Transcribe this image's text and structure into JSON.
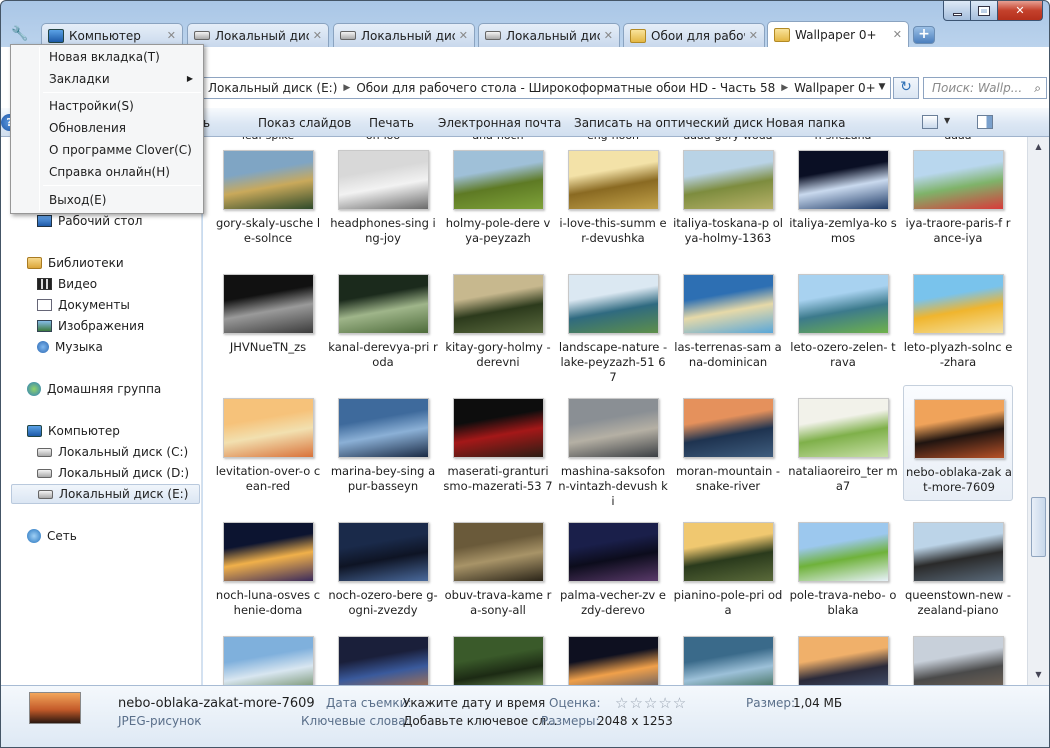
{
  "window": {
    "minimize": "—",
    "maximize": "□",
    "close": "✕"
  },
  "tabs": [
    {
      "label": "Компьютер",
      "icon": "computer-icon",
      "close": "✕"
    },
    {
      "label": "Локальный диск",
      "icon": "drive-icon",
      "close": "✕"
    },
    {
      "label": "Локальный диск",
      "icon": "drive-icon",
      "close": "✕"
    },
    {
      "label": "Локальный диск",
      "icon": "drive-icon",
      "close": "✕"
    },
    {
      "label": "Обои для рабочего стола",
      "icon": "folder-icon",
      "close": "✕"
    },
    {
      "label": "Wallpaper 0+",
      "icon": "folder-icon",
      "close": "✕"
    }
  ],
  "new_tab": "+",
  "address": {
    "crumbs": [
      "Локальный диск (E:)",
      "Обои для рабочего стола - Широкоформатные обои HD - Часть 58",
      "Wallpaper 0+"
    ],
    "sep": "▶",
    "refresh": "↻",
    "search_placeholder": "Поиск: Wallp...",
    "search_icon": "⌕"
  },
  "commands": [
    "Показ слайдов",
    "Печать",
    "Электронная почта",
    "Записать на оптический диск",
    "Новая папка"
  ],
  "command_stub": "ь",
  "help": "?",
  "menu": {
    "items": [
      "Новая вкладка(T)",
      "Закладки",
      "Настройки(S)",
      "Обновления",
      "О программе Clover(C)",
      "Справка онлайн(H)",
      "Выход(E)"
    ],
    "submenu_arrow": "▶"
  },
  "nav": {
    "desktop": "Рабочий стол",
    "libraries": "Библиотеки",
    "video": "Видео",
    "documents": "Документы",
    "images": "Изображения",
    "music": "Музыка",
    "homegroup": "Домашняя группа",
    "computer": "Компьютер",
    "drive_c": "Локальный диск (C:)",
    "drive_d": "Локальный диск (D:)",
    "drive_e": "Локальный диск (E:)",
    "network": "Сеть"
  },
  "top_partial": [
    "leaf-spike",
    "on-ioo",
    "ana-noch",
    "eng-noon",
    "aaaa-gory-woda",
    "n-snezana",
    "aaaa"
  ],
  "files": [
    {
      "name": "gory-skaly-usche le-solnce",
      "colors": [
        "#7fa5c4",
        "#2e4a2a",
        "#c9a95b"
      ]
    },
    {
      "name": "headphones-sing ing-joy",
      "colors": [
        "#d8d8d8",
        "#6a6a6a",
        "#f2f2f2"
      ]
    },
    {
      "name": "holmy-pole-dere vya-peyzazh",
      "colors": [
        "#9fc0d8",
        "#7fa33a",
        "#5e7a24"
      ]
    },
    {
      "name": "i-love-this-summ er-devushka",
      "colors": [
        "#f3e2a8",
        "#c2a24a",
        "#8a6a22"
      ]
    },
    {
      "name": "italiya-toskana-p olya-holmy-1363",
      "colors": [
        "#b9d3e6",
        "#b8b26a",
        "#7d8c3e"
      ]
    },
    {
      "name": "italiya-zemlya-ko smos",
      "colors": [
        "#0a0f24",
        "#1e3a66",
        "#c9d9ee"
      ]
    },
    {
      "name": "iya-traore-paris-f rance-iya",
      "colors": [
        "#b9d7ee",
        "#d93a3a",
        "#7fb36a"
      ]
    },
    {
      "name": "JHVNueTN_zs",
      "colors": [
        "#111",
        "#3b3b3b",
        "#9a9a9a"
      ]
    },
    {
      "name": "kanal-derevya-pri roda",
      "colors": [
        "#1b2a1c",
        "#4d6b3a",
        "#9fb58a"
      ]
    },
    {
      "name": "kitay-gory-holmy -derevni",
      "colors": [
        "#c7b88e",
        "#5a6a3e",
        "#2c3a1c"
      ]
    },
    {
      "name": "landscape-nature -lake-peyzazh-51 67",
      "colors": [
        "#dbe8f2",
        "#5e8f4a",
        "#2f6a80"
      ]
    },
    {
      "name": "las-terrenas-sam ana-dominican",
      "colors": [
        "#2d6fb3",
        "#59a7d9",
        "#e6d9a8"
      ]
    },
    {
      "name": "leto-ozero-zelen- trava",
      "colors": [
        "#a8d2f0",
        "#6fb24a",
        "#3c7a8c"
      ]
    },
    {
      "name": "leto-plyazh-solnc e-zhara",
      "colors": [
        "#79c3ec",
        "#f5e2a0",
        "#f0b52e"
      ]
    },
    {
      "name": "levitation-over-o cean-red",
      "colors": [
        "#f6c27a",
        "#d9723a",
        "#f2e0b0"
      ]
    },
    {
      "name": "marina-bey-sing apur-basseyn",
      "colors": [
        "#3e6a9c",
        "#1a2a44",
        "#8bb0d6"
      ]
    },
    {
      "name": "maserati-granturi smo-mazerati-53 7",
      "colors": [
        "#0d0d0d",
        "#2b1d14",
        "#a41818"
      ]
    },
    {
      "name": "mashina-saksofon n-vintazh-devush ki",
      "colors": [
        "#8a8f94",
        "#3b3f44",
        "#b5b0a4"
      ]
    },
    {
      "name": "moran-mountain -snake-river",
      "colors": [
        "#e5915c",
        "#3f5d7e",
        "#1e3350"
      ]
    },
    {
      "name": "nataliaoreiro_ter ma7",
      "colors": [
        "#f2f2ea",
        "#c9e0a8",
        "#7fb04a"
      ]
    },
    {
      "name": "nebo-oblaka-zak at-more-7609",
      "colors": [
        "#f0a35a",
        "#b85228",
        "#1f1410"
      ]
    },
    {
      "name": "noch-luna-osves chenie-doma",
      "colors": [
        "#0c1430",
        "#3a2a5c",
        "#f0b04a"
      ]
    },
    {
      "name": "noch-ozero-bere g-ogni-zvezdy",
      "colors": [
        "#1a2a4a",
        "#4a6a9c",
        "#0e1424"
      ]
    },
    {
      "name": "obuv-trava-kame ra-sony-all",
      "colors": [
        "#6a5a3a",
        "#2a2418",
        "#a89468"
      ]
    },
    {
      "name": "palma-vecher-zv ezdy-derevo",
      "colors": [
        "#1a1f4a",
        "#5a3a6a",
        "#0c0c1c"
      ]
    },
    {
      "name": "pianino-pole-pri oda",
      "colors": [
        "#f0c870",
        "#5a6a3a",
        "#2a3a1c"
      ]
    },
    {
      "name": "pole-trava-nebo- oblaka",
      "colors": [
        "#9cc8ee",
        "#e8f2fa",
        "#6fb23a"
      ]
    },
    {
      "name": "queenstown-new -zealand-piano",
      "colors": [
        "#bcd4e8",
        "#5a6a7a",
        "#2a2a2a"
      ]
    },
    {
      "name": "",
      "colors": [
        "#7fb0dc",
        "#5a7a4a",
        "#d8e6f0"
      ]
    },
    {
      "name": "",
      "colors": [
        "#1a1f3a",
        "#c87a3a",
        "#3a5a9c"
      ]
    },
    {
      "name": "",
      "colors": [
        "#3a5a2a",
        "#8ab06a",
        "#1c2a14"
      ]
    },
    {
      "name": "",
      "colors": [
        "#0e1020",
        "#3a4a6a",
        "#f0a04a"
      ]
    },
    {
      "name": "",
      "colors": [
        "#3a6a8a",
        "#2a5a3a",
        "#9cc0d8"
      ]
    },
    {
      "name": "",
      "colors": [
        "#f0b06a",
        "#4a5a7a",
        "#2a2a3a"
      ]
    },
    {
      "name": "",
      "colors": [
        "#c8d0da",
        "#7a6a5a",
        "#4a4a4a"
      ]
    }
  ],
  "details": {
    "filename": "nebo-oblaka-zakat-more-7609",
    "filetype": "JPEG-рисунок",
    "date_label": "Дата съемки:",
    "date_value": "Укажите дату и время",
    "rating_label": "Оценка:",
    "rating_stars": "☆☆☆☆☆",
    "size_label": "Размер:",
    "size_value": "1,04 МБ",
    "keywords_label": "Ключевые слова:",
    "keywords_value": "Добавьте ключевое сл...",
    "dims_label": "Размеры:",
    "dims_value": "2048 x 1253"
  },
  "scroll": {
    "up": "▲",
    "down": "▼"
  }
}
